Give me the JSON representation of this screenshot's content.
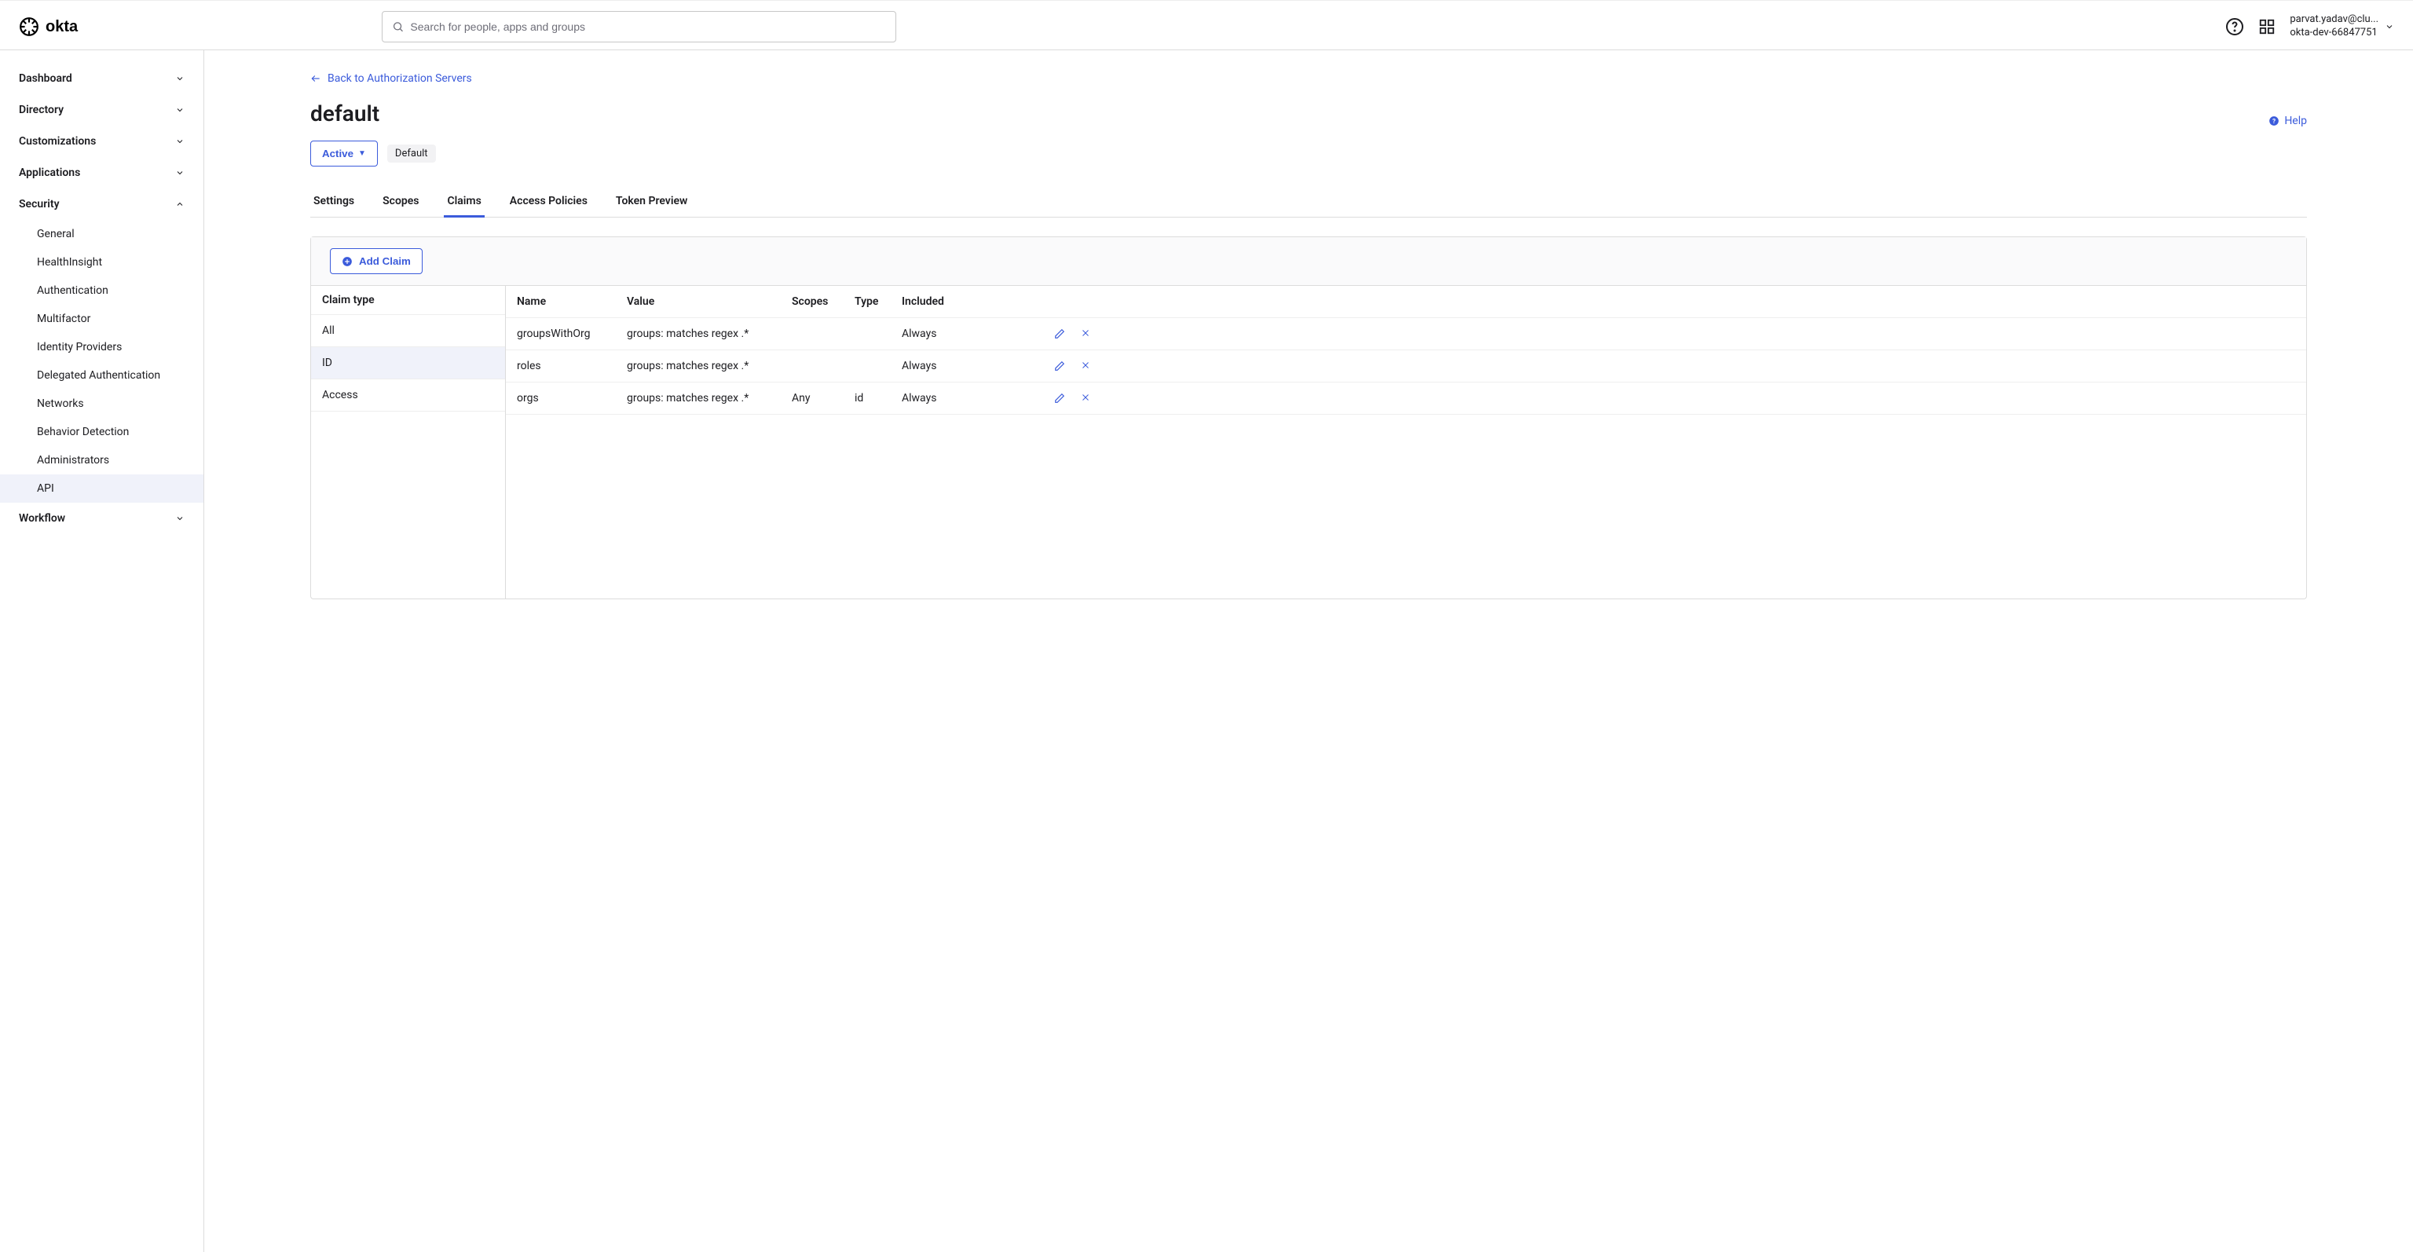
{
  "search": {
    "placeholder": "Search for people, apps and groups"
  },
  "user": {
    "email": "parvat.yadav@clu...",
    "org": "okta-dev-66847751"
  },
  "sidebar": {
    "items": [
      {
        "label": "Dashboard",
        "expanded": false
      },
      {
        "label": "Directory",
        "expanded": false
      },
      {
        "label": "Customizations",
        "expanded": false
      },
      {
        "label": "Applications",
        "expanded": false
      },
      {
        "label": "Security",
        "expanded": true,
        "subitems": [
          {
            "label": "General"
          },
          {
            "label": "HealthInsight"
          },
          {
            "label": "Authentication"
          },
          {
            "label": "Multifactor"
          },
          {
            "label": "Identity Providers"
          },
          {
            "label": "Delegated Authentication"
          },
          {
            "label": "Networks"
          },
          {
            "label": "Behavior Detection"
          },
          {
            "label": "Administrators"
          },
          {
            "label": "API",
            "active": true
          }
        ]
      },
      {
        "label": "Workflow",
        "expanded": false
      }
    ]
  },
  "back_link": "Back to Authorization Servers",
  "page_title": "default",
  "help_label": "Help",
  "status": {
    "active_label": "Active",
    "default_label": "Default"
  },
  "tabs": [
    {
      "label": "Settings"
    },
    {
      "label": "Scopes"
    },
    {
      "label": "Claims",
      "active": true
    },
    {
      "label": "Access Policies"
    },
    {
      "label": "Token Preview"
    }
  ],
  "add_claim_label": "Add Claim",
  "claim_type_header": "Claim type",
  "claim_types": [
    {
      "label": "All"
    },
    {
      "label": "ID",
      "selected": true
    },
    {
      "label": "Access"
    }
  ],
  "columns": {
    "name": "Name",
    "value": "Value",
    "scopes": "Scopes",
    "type": "Type",
    "included": "Included"
  },
  "claims": [
    {
      "name": "groupsWithOrg",
      "value": "groups: matches regex .*",
      "scopes": "",
      "type": "",
      "included": "Always"
    },
    {
      "name": "roles",
      "value": "groups: matches regex .*",
      "scopes": "",
      "type": "",
      "included": "Always"
    },
    {
      "name": "orgs",
      "value": "groups: matches regex .*",
      "scopes": "Any",
      "type": "id",
      "included": "Always"
    }
  ]
}
